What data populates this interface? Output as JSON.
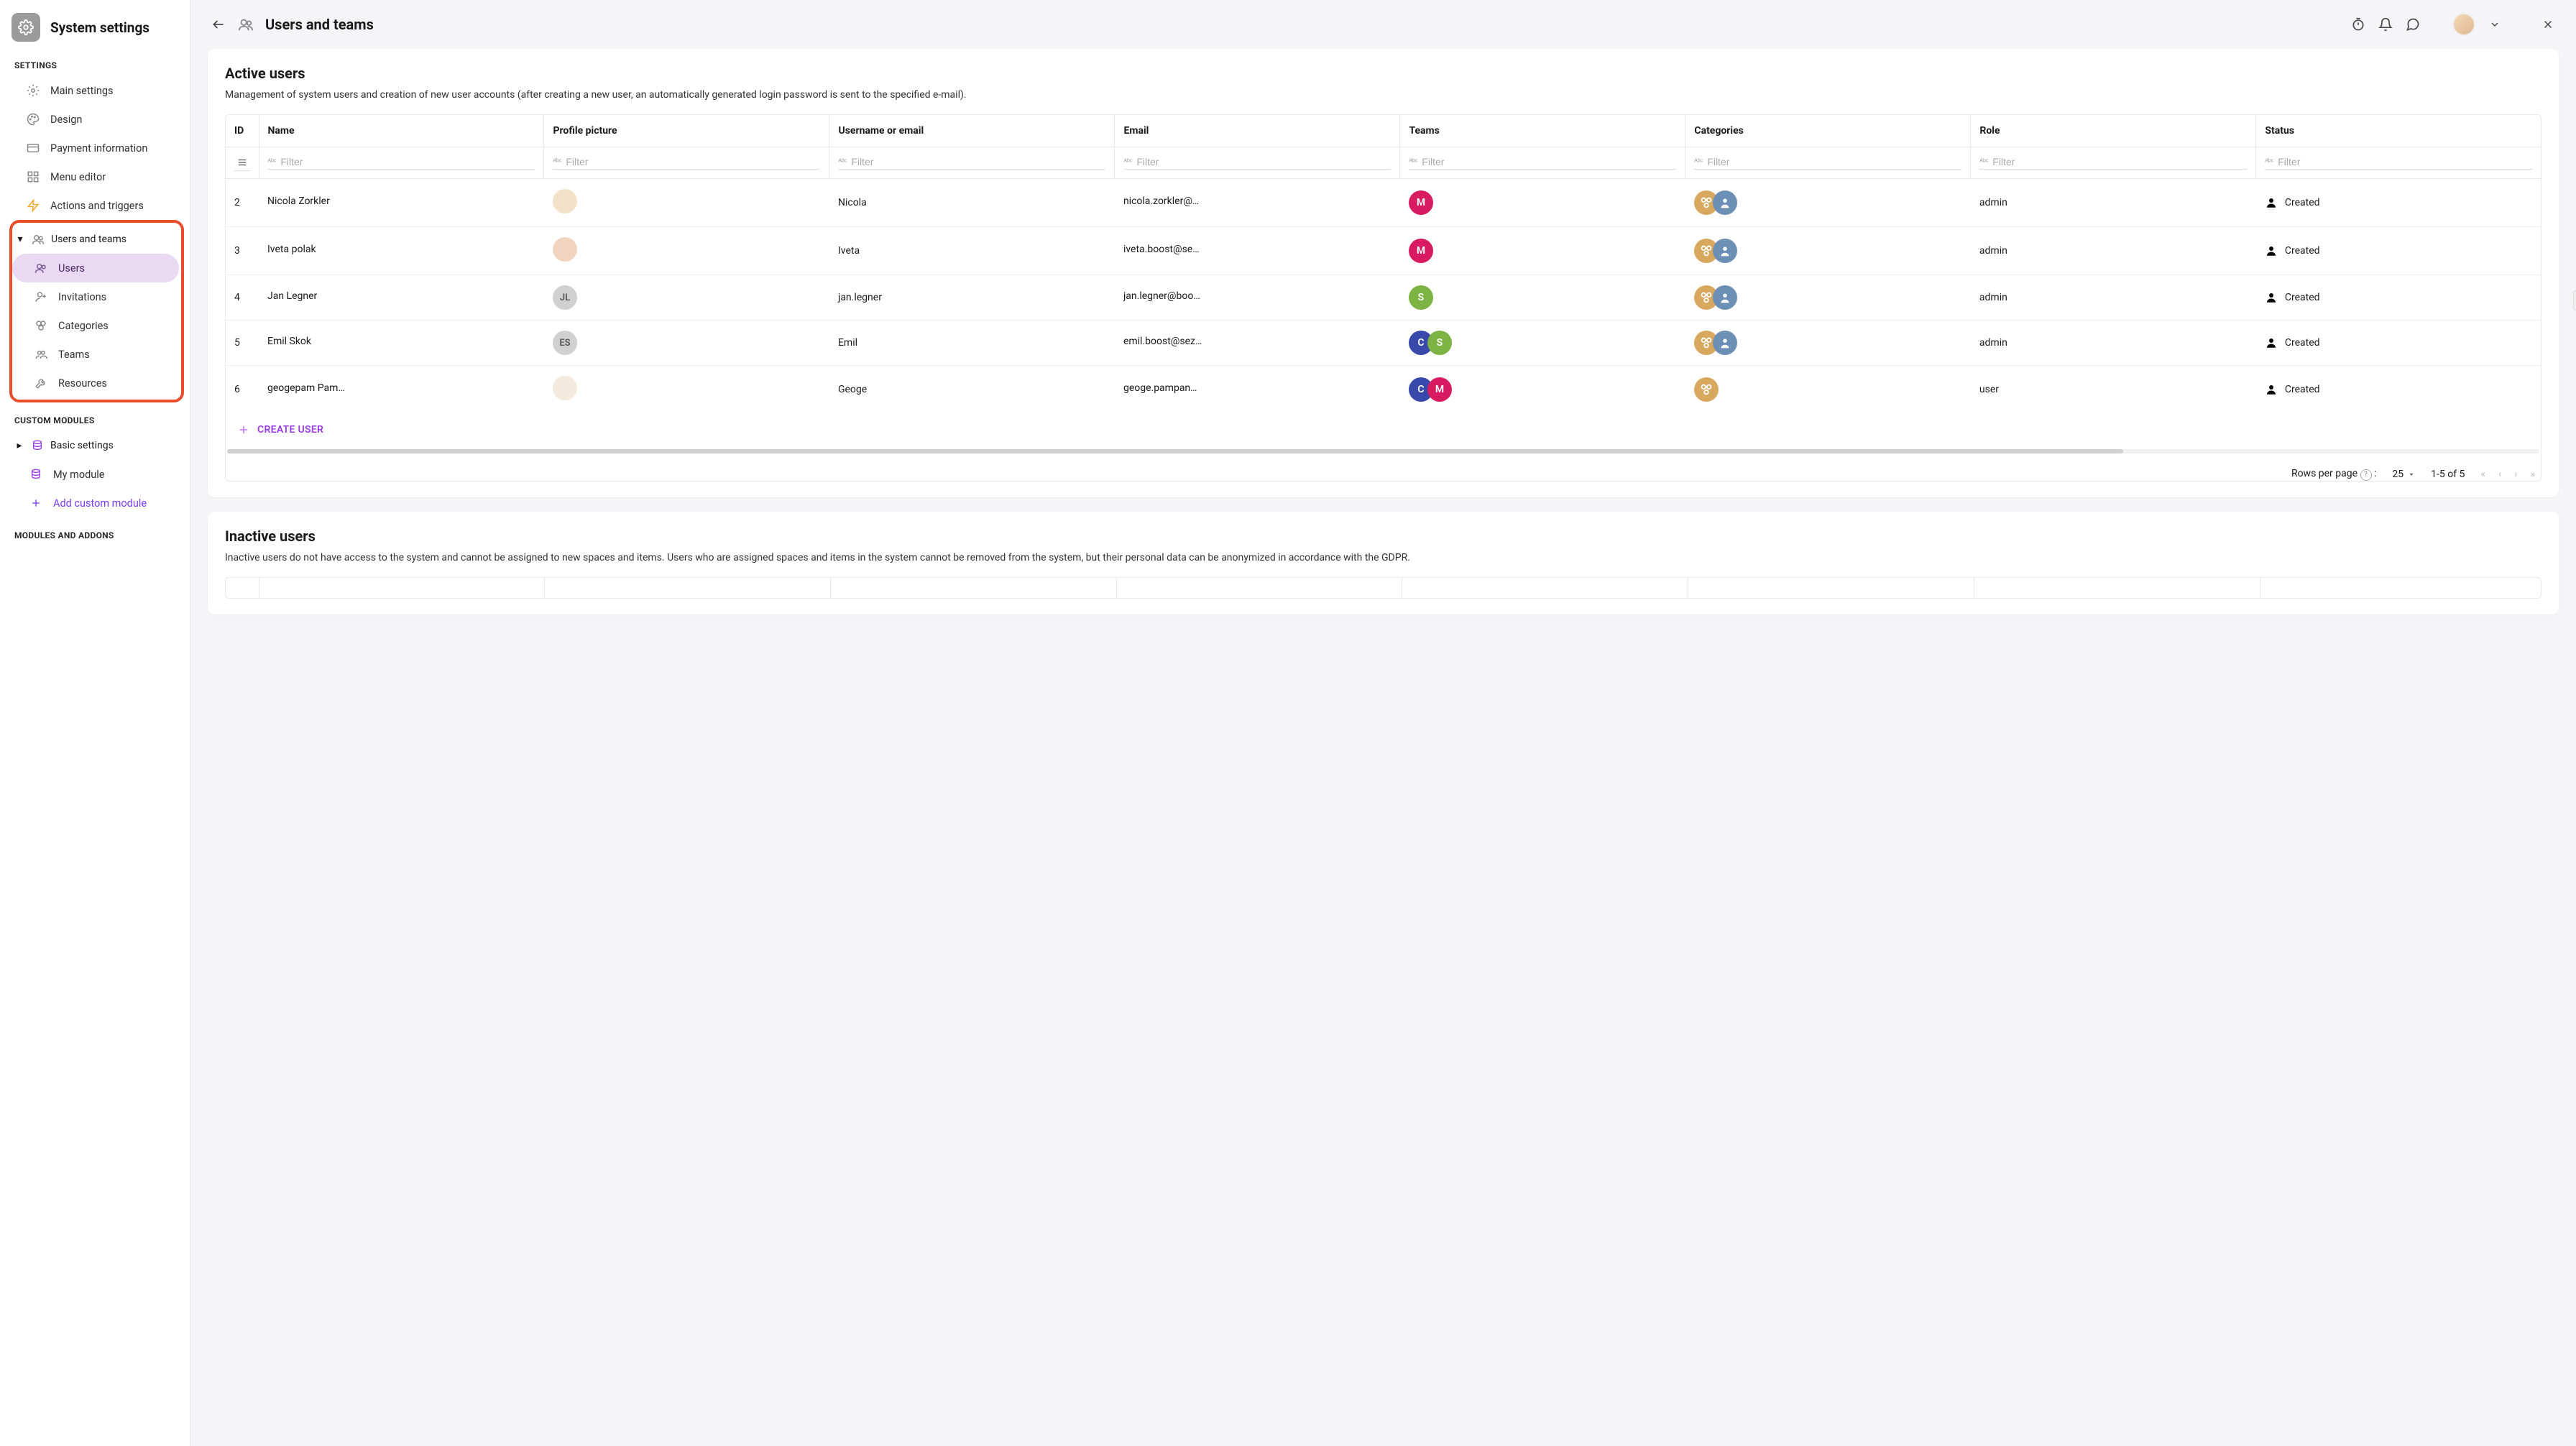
{
  "sidebar": {
    "title": "System settings",
    "sections": {
      "settings_label": "SETTINGS",
      "custom_modules_label": "CUSTOM MODULES",
      "modules_addons_label": "MODULES AND ADDONS"
    },
    "items": {
      "main_settings": "Main settings",
      "design": "Design",
      "payment": "Payment information",
      "menu_editor": "Menu editor",
      "actions_triggers": "Actions and triggers",
      "users_teams": "Users and teams",
      "users": "Users",
      "invitations": "Invitations",
      "categories": "Categories",
      "teams": "Teams",
      "resources": "Resources",
      "basic_settings": "Basic settings",
      "my_module": "My module",
      "add_custom": "Add custom module"
    }
  },
  "topbar": {
    "title": "Users and teams"
  },
  "active": {
    "title": "Active users",
    "desc": "Management of system users and creation of new user accounts (after creating a new user, an automatically generated login password is sent to the specified e-mail).",
    "columns": {
      "id": "ID",
      "name": "Name",
      "profile_picture": "Profile picture",
      "username": "Username or email",
      "email": "Email",
      "teams": "Teams",
      "categories": "Categories",
      "role": "Role",
      "status": "Status"
    },
    "filter_placeholder": "Filter",
    "rows": [
      {
        "id": "2",
        "name": "Nicola Zorkler",
        "initials": "",
        "pic_bg": "#f3e2c9",
        "username": "Nicola",
        "email": "nicola.zorkler@boo...",
        "teams": [
          {
            "t": "M",
            "c": "#d81b60"
          }
        ],
        "cats": 2,
        "role": "admin",
        "status": "Created"
      },
      {
        "id": "3",
        "name": "Iveta polak",
        "initials": "",
        "pic_bg": "#f0d4c0",
        "username": "Iveta",
        "email": "iveta.boost@sezna...",
        "teams": [
          {
            "t": "M",
            "c": "#d81b60"
          }
        ],
        "cats": 2,
        "role": "admin",
        "status": "Created"
      },
      {
        "id": "4",
        "name": "Jan Legner",
        "initials": "JL",
        "pic_bg": "#d0d0d0",
        "username": "jan.legner",
        "email": "jan.legner@boost.s...",
        "teams": [
          {
            "t": "S",
            "c": "#7cb342"
          }
        ],
        "cats": 2,
        "role": "admin",
        "status": "Created"
      },
      {
        "id": "5",
        "name": "Emil Skok",
        "initials": "ES",
        "pic_bg": "#d0d0d0",
        "username": "Emil",
        "email": "emil.boost@sezna...",
        "teams": [
          {
            "t": "C",
            "c": "#3949ab"
          },
          {
            "t": "S",
            "c": "#7cb342"
          }
        ],
        "cats": 2,
        "role": "admin",
        "status": "Created"
      },
      {
        "id": "6",
        "name": "geogepam Pampan...",
        "initials": "",
        "pic_bg": "#f3e9dc",
        "username": "Geoge",
        "email": "geoge.pampanas@...",
        "teams": [
          {
            "t": "C",
            "c": "#3949ab"
          },
          {
            "t": "M",
            "c": "#d81b60"
          }
        ],
        "cats": 1,
        "role": "user",
        "status": "Created"
      }
    ],
    "create_user": "CREATE USER",
    "pagination": {
      "rows_per_page": "Rows per page",
      "size": "25",
      "range": "1-5 of 5"
    }
  },
  "inactive": {
    "title": "Inactive users",
    "desc": "Inactive users do not have access to the system and cannot be assigned to new spaces and items. Users who are assigned spaces and items in the system cannot be removed from the system, but their personal data can be anonymized in accordance with the GDPR."
  }
}
